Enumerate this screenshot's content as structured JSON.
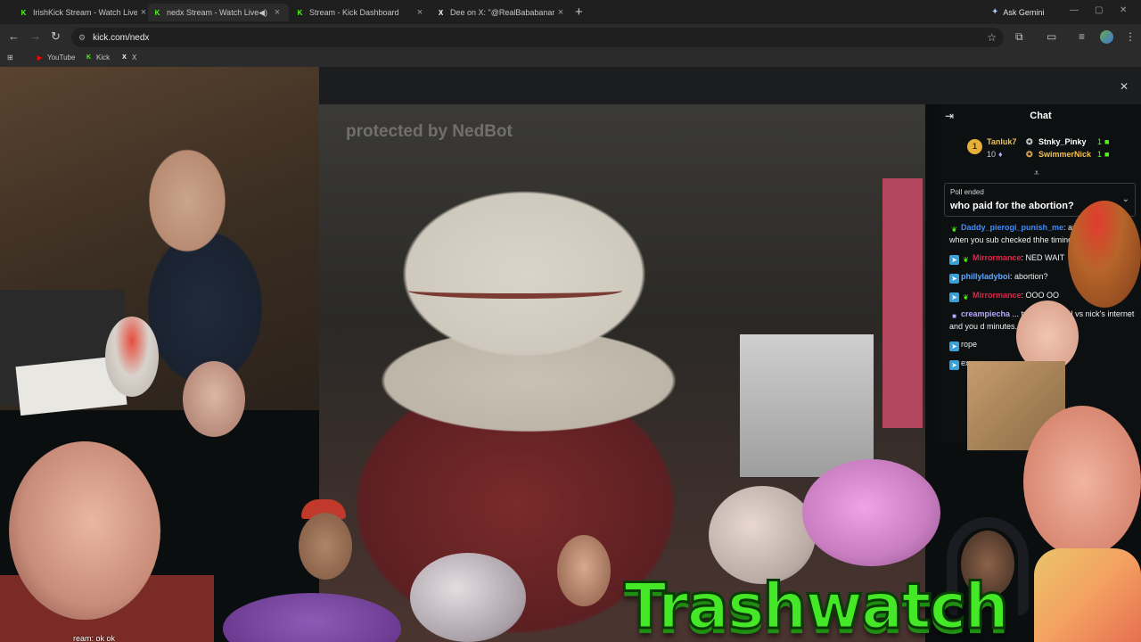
{
  "browser": {
    "tabs": [
      {
        "title": "IrishKick Stream - Watch Live o",
        "favicon": "kick-icon",
        "active": false
      },
      {
        "title": "nedx Stream - Watch Live o",
        "favicon": "kick-icon",
        "active": true,
        "audio": true
      },
      {
        "title": "Stream - Kick Dashboard",
        "favicon": "kick-icon",
        "active": false
      },
      {
        "title": "Dee on X: \"@RealBababanaras",
        "favicon": "x-icon",
        "active": false
      }
    ],
    "gemini_label": "Ask Gemini",
    "url": "kick.com/nedx",
    "bookmarks": [
      {
        "label": "YouTube",
        "icon": "youtube-icon"
      },
      {
        "label": "Kick",
        "icon": "kick-icon"
      },
      {
        "label": "X",
        "icon": "x-icon"
      }
    ]
  },
  "stream": {
    "watermark": "protected by NedBot",
    "caption": "ream: ok ok",
    "logo_text": "Trashwatch"
  },
  "chat": {
    "title": "Chat",
    "leaderboard": {
      "first": {
        "rank": "1",
        "name": "Tanluk7",
        "count": "10"
      },
      "second": {
        "name": "Stnky_Pinky",
        "count": "1"
      },
      "third": {
        "name": "SwimmerNick",
        "count": "1"
      }
    },
    "poll": {
      "status": "Poll ended",
      "question": "who paid for the abortion?"
    },
    "messages": [
      {
        "user": "Daddy_pierogi_punish_me",
        "user_color": "#3d8cff",
        "text": ": are ure names and when you sub checked thhe timings we pay fu",
        "badge": "leaf"
      },
      {
        "user": "Mirrormance",
        "user_color": "#e0264a",
        "text": ": NED WAIT",
        "badge": "kick"
      },
      {
        "user": "phillyladyboi",
        "user_color": "#5fa8ff",
        "text": ": abortion?",
        "badge": "kick"
      },
      {
        "user": "Mirrormance",
        "user_color": "#e0264a",
        "text": ": OOO OO",
        "badge": "kick"
      },
      {
        "user": "creampiecha",
        "user_color": "#b8a6ff",
        "text": " ... tween channel vs nick's internet and you d minutes.",
        "badge": "sub"
      },
      {
        "user": "",
        "user_color": "#5fa8ff",
        "text": "rope",
        "badge": "kick"
      },
      {
        "user": "",
        "user_color": "#5fa8ff",
        "text": "exe",
        "badge": "kick"
      }
    ]
  },
  "colors": {
    "kick_green": "#53fc18",
    "logo_green": "#45e827",
    "chat_bg": "#0e1011"
  }
}
